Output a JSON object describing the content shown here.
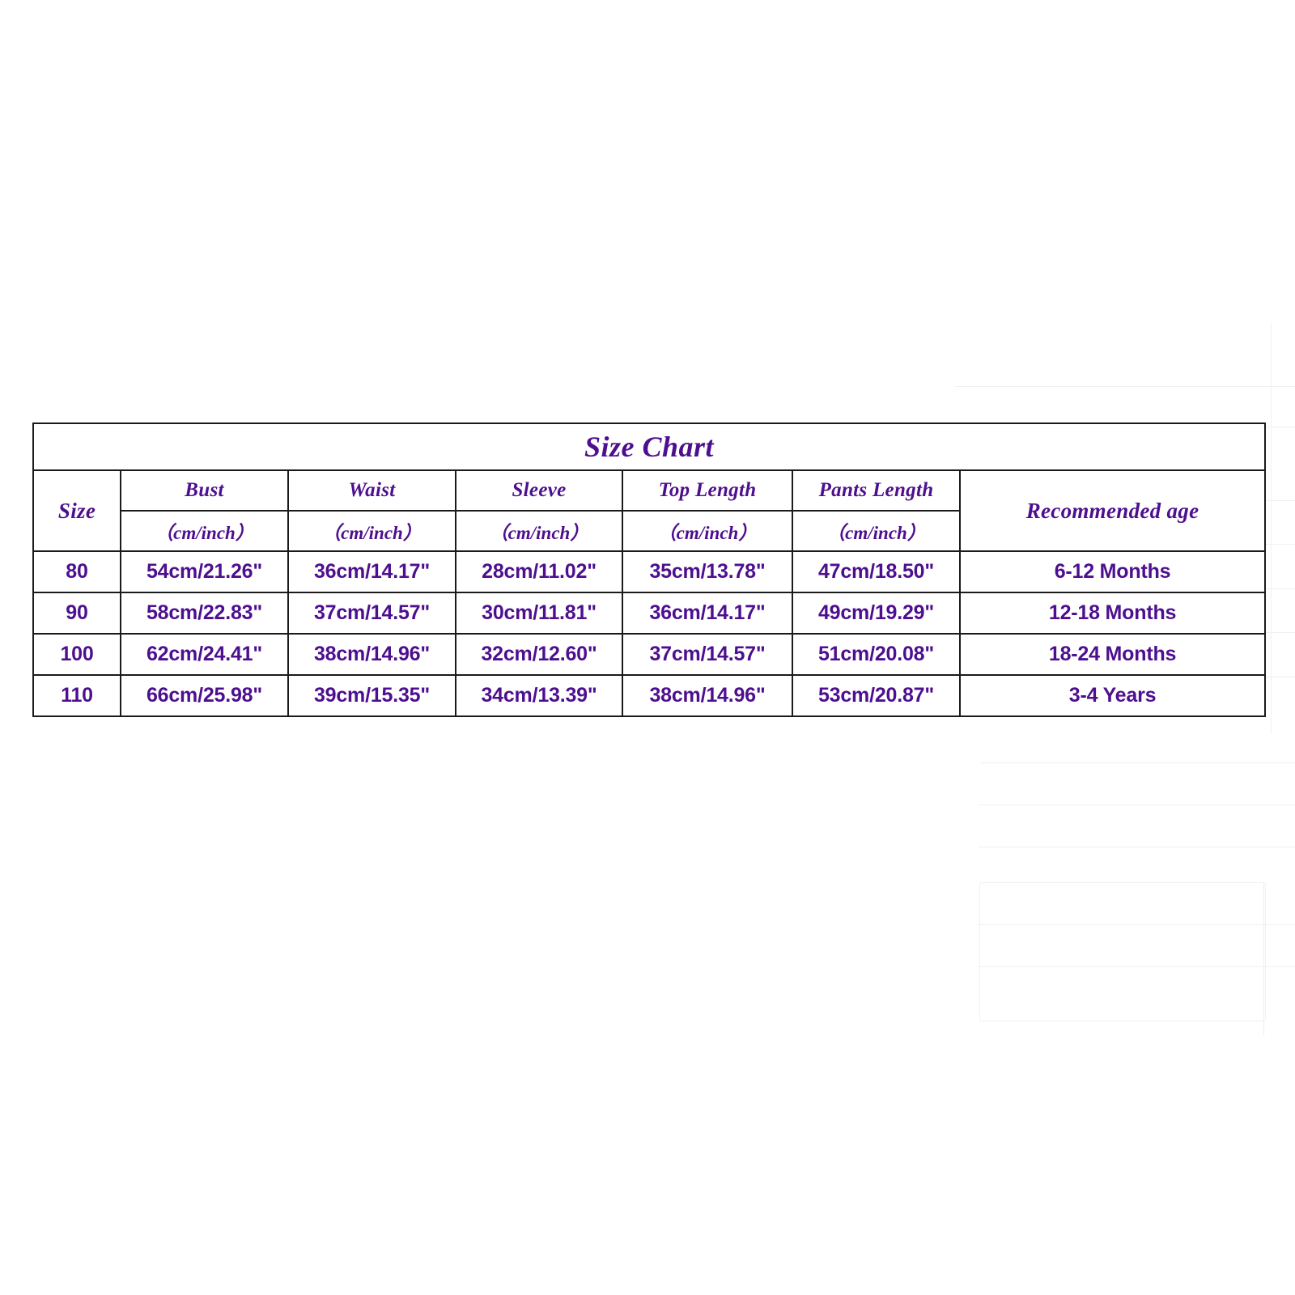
{
  "table": {
    "title": "Size Chart",
    "size_header": "Size",
    "age_header": "Recommended age",
    "unit_label": "（cm/inch）",
    "measure_headers": [
      "Bust",
      "Waist",
      "Sleeve",
      "Top Length",
      "Pants Length"
    ],
    "rows": [
      {
        "size": "80",
        "bust": "54cm/21.26\"",
        "waist": "36cm/14.17\"",
        "sleeve": "28cm/11.02\"",
        "top_length": "35cm/13.78\"",
        "pants_length": "47cm/18.50\"",
        "age": "6-12 Months"
      },
      {
        "size": "90",
        "bust": "58cm/22.83\"",
        "waist": "37cm/14.57\"",
        "sleeve": "30cm/11.81\"",
        "top_length": "36cm/14.17\"",
        "pants_length": "49cm/19.29\"",
        "age": "12-18 Months"
      },
      {
        "size": "100",
        "bust": "62cm/24.41\"",
        "waist": "38cm/14.96\"",
        "sleeve": "32cm/12.60\"",
        "top_length": "37cm/14.57\"",
        "pants_length": "51cm/20.08\"",
        "age": "18-24 Months"
      },
      {
        "size": "110",
        "bust": "66cm/25.98\"",
        "waist": "39cm/15.35\"",
        "sleeve": "34cm/13.39\"",
        "top_length": "38cm/14.96\"",
        "pants_length": "53cm/20.87\"",
        "age": "3-4 Years"
      }
    ]
  },
  "colors": {
    "text_purple": "#4d0f8f",
    "border": "#1a1a1a",
    "background": "#ffffff",
    "ghost_line": "#f0f0f0"
  }
}
